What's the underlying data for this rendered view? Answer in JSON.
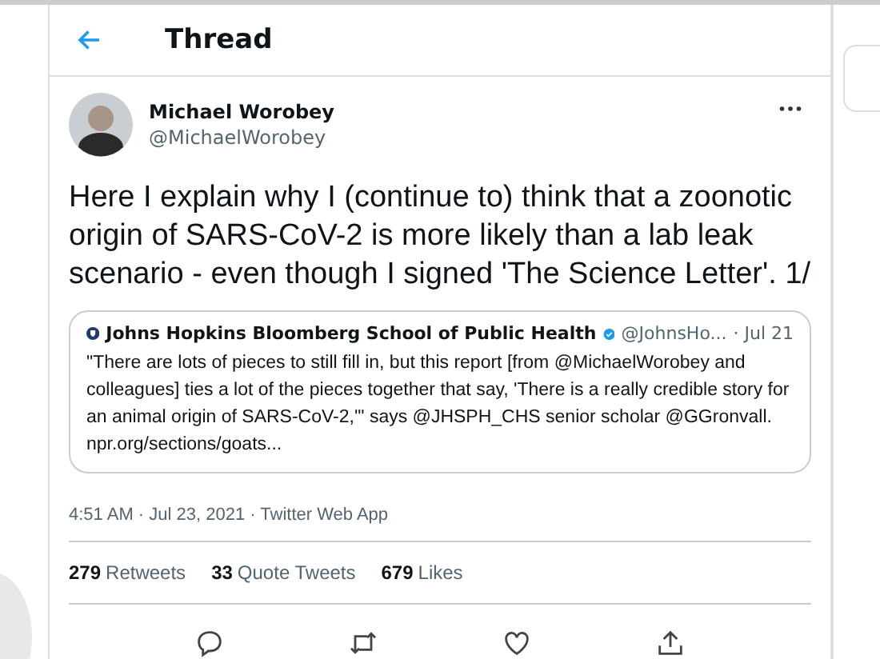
{
  "header": {
    "title": "Thread"
  },
  "tweet": {
    "name": "Michael Worobey",
    "handle": "@MichaelWorobey",
    "text": "Here I explain why I (continue to) think that a zoonotic origin of SARS-CoV-2 is more likely than a lab leak scenario - even though I signed 'The Science Letter'. 1/",
    "quote": {
      "name": "Johns Hopkins Bloomberg School of Public Health",
      "verified": true,
      "handle": "@JohnsHo...",
      "date": "· Jul 21",
      "text": "\"There are lots of pieces to still fill in, but this report [from @MichaelWorobey and colleagues] ties a lot of the pieces together that say, 'There is a really credible story for an animal origin of SARS-CoV-2,'\" says @JHSPH_CHS senior scholar @GGronvall. npr.org/sections/goats..."
    },
    "timestamp": "4:51 AM · Jul 23, 2021 · Twitter Web App",
    "stats": [
      {
        "count": "279",
        "label": "Retweets"
      },
      {
        "count": "33",
        "label": "Quote Tweets"
      },
      {
        "count": "679",
        "label": "Likes"
      }
    ],
    "actions": [
      {
        "kind": "reply"
      },
      {
        "kind": "retweet"
      },
      {
        "kind": "like"
      },
      {
        "kind": "share"
      }
    ]
  }
}
